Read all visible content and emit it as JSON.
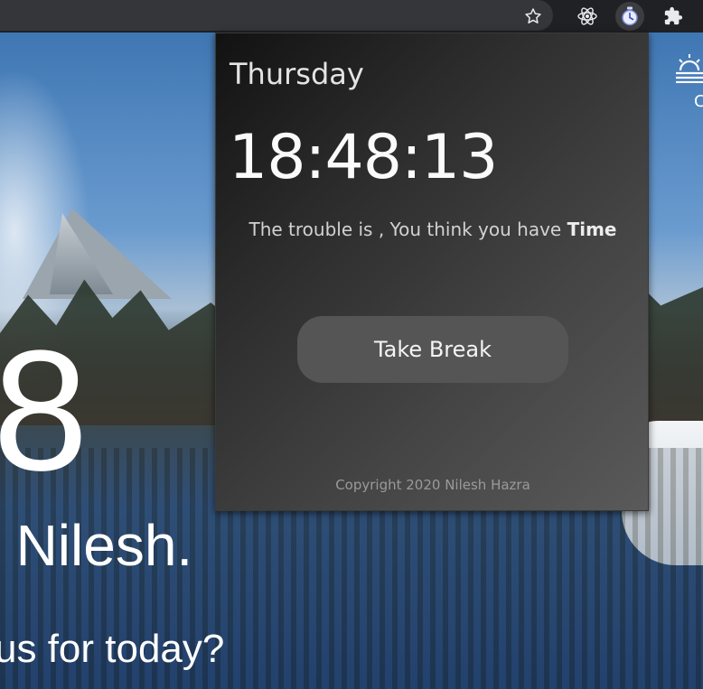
{
  "popup": {
    "day": "Thursday",
    "time": "18:48:13",
    "quote_prefix": "The trouble is , You think you have ",
    "quote_emphasis": "Time",
    "break_button_label": "Take Break",
    "copyright": "Copyright 2020 Nilesh Hazra"
  },
  "background": {
    "clock_fragment": "8",
    "greeting_fragment": ", Nilesh.",
    "focus_fragment": "cus for today?",
    "weather_fragment": "C"
  },
  "toolbar": {
    "icons": [
      "star-icon",
      "react-devtools-icon",
      "timer-extension-icon",
      "puzzle-extensions-icon"
    ]
  },
  "colors": {
    "popup_bg_dark": "#121212",
    "popup_bg_light": "#5a5a5a",
    "button_bg": "#555555",
    "toolbar_bg": "#202124",
    "react_blue": "#61dafb"
  }
}
